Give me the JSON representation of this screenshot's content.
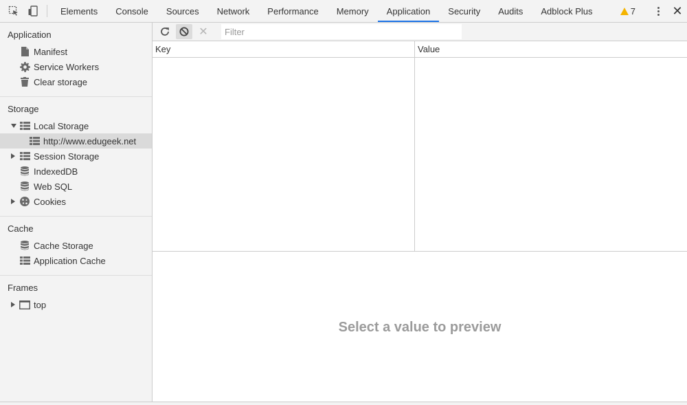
{
  "topbar": {
    "tabs": [
      {
        "label": "Elements"
      },
      {
        "label": "Console"
      },
      {
        "label": "Sources"
      },
      {
        "label": "Network"
      },
      {
        "label": "Performance"
      },
      {
        "label": "Memory"
      },
      {
        "label": "Application",
        "active": true
      },
      {
        "label": "Security"
      },
      {
        "label": "Audits"
      },
      {
        "label": "Adblock Plus"
      }
    ],
    "warning_count": "7",
    "icons": [
      "inspect-icon",
      "device-toggle-icon",
      "warning-icon",
      "more-vert-icon",
      "close-icon"
    ]
  },
  "sidebar": {
    "application": {
      "title": "Application",
      "items": [
        "Manifest",
        "Service Workers",
        "Clear storage"
      ]
    },
    "storage": {
      "title": "Storage",
      "local_storage": "Local Storage",
      "local_storage_origin": "http://www.edugeek.net",
      "session_storage": "Session Storage",
      "indexeddb": "IndexedDB",
      "websql": "Web SQL",
      "cookies": "Cookies"
    },
    "cache": {
      "title": "Cache",
      "items": [
        "Cache Storage",
        "Application Cache"
      ]
    },
    "frames": {
      "title": "Frames",
      "top": "top"
    }
  },
  "main": {
    "filter_placeholder": "Filter",
    "columns": {
      "key": "Key",
      "value": "Value"
    },
    "preview_text": "Select a value to preview"
  },
  "colors": {
    "accent": "#1a73e8",
    "warning": "#f4b400",
    "panel_bg": "#f3f3f3",
    "selected_bg": "#dadada"
  }
}
